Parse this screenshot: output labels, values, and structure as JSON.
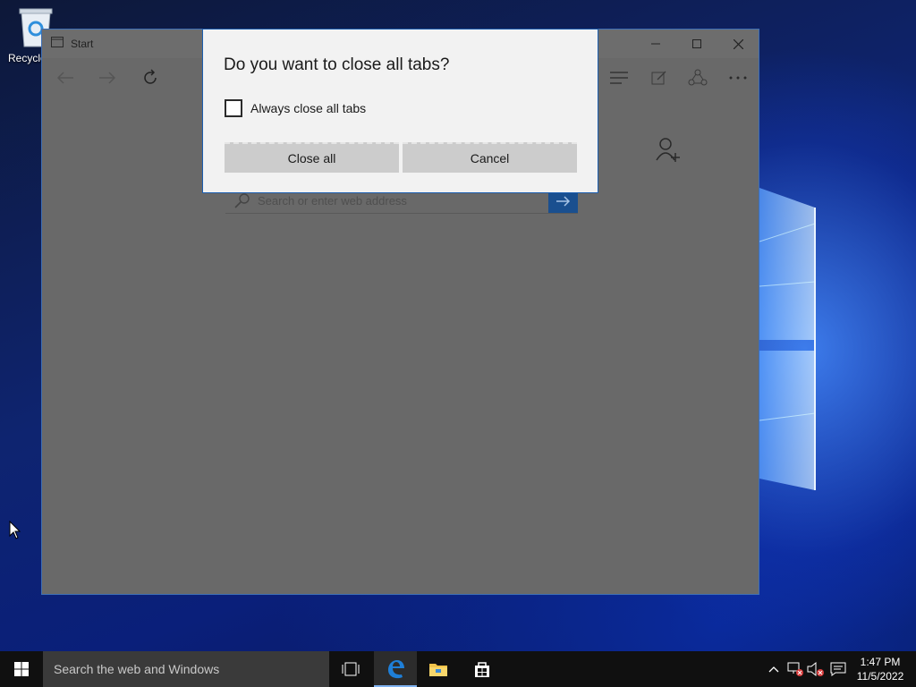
{
  "desktop": {
    "recycle_bin_label": "Recycle"
  },
  "browser": {
    "tab_title": "Start",
    "search_placeholder": "Search or enter web address"
  },
  "dialog": {
    "title": "Do you want to close all tabs?",
    "checkbox_label": "Always close all tabs",
    "checkbox_checked": false,
    "close_all_label": "Close all",
    "cancel_label": "Cancel"
  },
  "taskbar": {
    "search_placeholder": "Search the web and Windows",
    "time": "1:47 PM",
    "date": "11/5/2022",
    "pinned_icons": [
      "task-view-icon",
      "edge-icon",
      "file-explorer-icon",
      "store-icon"
    ],
    "tray_icons": [
      "show-hidden-icons-icon",
      "network-icon",
      "volume-icon",
      "action-center-icon"
    ]
  },
  "colors": {
    "accent": "#1d5fb0",
    "dialog_bg": "#f2f2f2",
    "button_bg": "#cccccc",
    "overlay": "#696969",
    "taskbar": "#101010"
  }
}
